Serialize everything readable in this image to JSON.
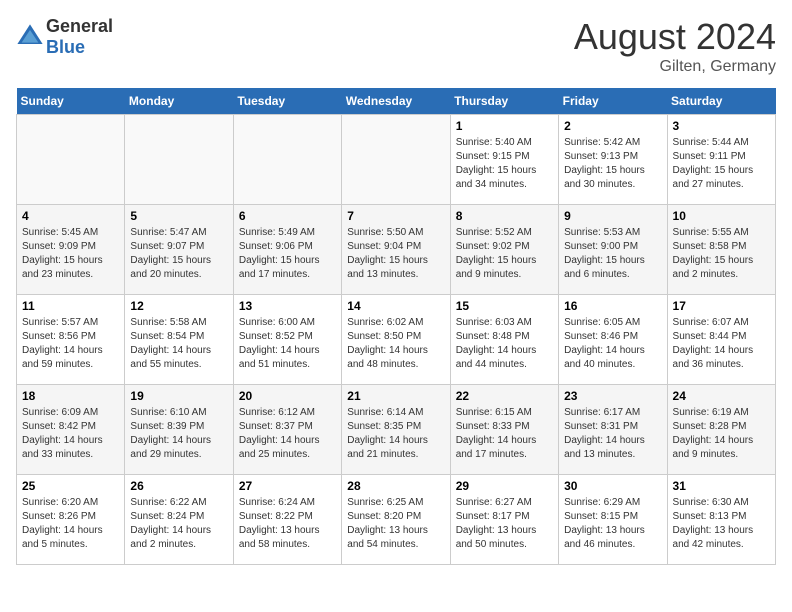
{
  "header": {
    "logo": {
      "general": "General",
      "blue": "Blue"
    },
    "month_year": "August 2024",
    "location": "Gilten, Germany"
  },
  "weekdays": [
    "Sunday",
    "Monday",
    "Tuesday",
    "Wednesday",
    "Thursday",
    "Friday",
    "Saturday"
  ],
  "weeks": [
    [
      {
        "day": "",
        "info": ""
      },
      {
        "day": "",
        "info": ""
      },
      {
        "day": "",
        "info": ""
      },
      {
        "day": "",
        "info": ""
      },
      {
        "day": "1",
        "info": "Sunrise: 5:40 AM\nSunset: 9:15 PM\nDaylight: 15 hours\nand 34 minutes."
      },
      {
        "day": "2",
        "info": "Sunrise: 5:42 AM\nSunset: 9:13 PM\nDaylight: 15 hours\nand 30 minutes."
      },
      {
        "day": "3",
        "info": "Sunrise: 5:44 AM\nSunset: 9:11 PM\nDaylight: 15 hours\nand 27 minutes."
      }
    ],
    [
      {
        "day": "4",
        "info": "Sunrise: 5:45 AM\nSunset: 9:09 PM\nDaylight: 15 hours\nand 23 minutes."
      },
      {
        "day": "5",
        "info": "Sunrise: 5:47 AM\nSunset: 9:07 PM\nDaylight: 15 hours\nand 20 minutes."
      },
      {
        "day": "6",
        "info": "Sunrise: 5:49 AM\nSunset: 9:06 PM\nDaylight: 15 hours\nand 17 minutes."
      },
      {
        "day": "7",
        "info": "Sunrise: 5:50 AM\nSunset: 9:04 PM\nDaylight: 15 hours\nand 13 minutes."
      },
      {
        "day": "8",
        "info": "Sunrise: 5:52 AM\nSunset: 9:02 PM\nDaylight: 15 hours\nand 9 minutes."
      },
      {
        "day": "9",
        "info": "Sunrise: 5:53 AM\nSunset: 9:00 PM\nDaylight: 15 hours\nand 6 minutes."
      },
      {
        "day": "10",
        "info": "Sunrise: 5:55 AM\nSunset: 8:58 PM\nDaylight: 15 hours\nand 2 minutes."
      }
    ],
    [
      {
        "day": "11",
        "info": "Sunrise: 5:57 AM\nSunset: 8:56 PM\nDaylight: 14 hours\nand 59 minutes."
      },
      {
        "day": "12",
        "info": "Sunrise: 5:58 AM\nSunset: 8:54 PM\nDaylight: 14 hours\nand 55 minutes."
      },
      {
        "day": "13",
        "info": "Sunrise: 6:00 AM\nSunset: 8:52 PM\nDaylight: 14 hours\nand 51 minutes."
      },
      {
        "day": "14",
        "info": "Sunrise: 6:02 AM\nSunset: 8:50 PM\nDaylight: 14 hours\nand 48 minutes."
      },
      {
        "day": "15",
        "info": "Sunrise: 6:03 AM\nSunset: 8:48 PM\nDaylight: 14 hours\nand 44 minutes."
      },
      {
        "day": "16",
        "info": "Sunrise: 6:05 AM\nSunset: 8:46 PM\nDaylight: 14 hours\nand 40 minutes."
      },
      {
        "day": "17",
        "info": "Sunrise: 6:07 AM\nSunset: 8:44 PM\nDaylight: 14 hours\nand 36 minutes."
      }
    ],
    [
      {
        "day": "18",
        "info": "Sunrise: 6:09 AM\nSunset: 8:42 PM\nDaylight: 14 hours\nand 33 minutes."
      },
      {
        "day": "19",
        "info": "Sunrise: 6:10 AM\nSunset: 8:39 PM\nDaylight: 14 hours\nand 29 minutes."
      },
      {
        "day": "20",
        "info": "Sunrise: 6:12 AM\nSunset: 8:37 PM\nDaylight: 14 hours\nand 25 minutes."
      },
      {
        "day": "21",
        "info": "Sunrise: 6:14 AM\nSunset: 8:35 PM\nDaylight: 14 hours\nand 21 minutes."
      },
      {
        "day": "22",
        "info": "Sunrise: 6:15 AM\nSunset: 8:33 PM\nDaylight: 14 hours\nand 17 minutes."
      },
      {
        "day": "23",
        "info": "Sunrise: 6:17 AM\nSunset: 8:31 PM\nDaylight: 14 hours\nand 13 minutes."
      },
      {
        "day": "24",
        "info": "Sunrise: 6:19 AM\nSunset: 8:28 PM\nDaylight: 14 hours\nand 9 minutes."
      }
    ],
    [
      {
        "day": "25",
        "info": "Sunrise: 6:20 AM\nSunset: 8:26 PM\nDaylight: 14 hours\nand 5 minutes."
      },
      {
        "day": "26",
        "info": "Sunrise: 6:22 AM\nSunset: 8:24 PM\nDaylight: 14 hours\nand 2 minutes."
      },
      {
        "day": "27",
        "info": "Sunrise: 6:24 AM\nSunset: 8:22 PM\nDaylight: 13 hours\nand 58 minutes."
      },
      {
        "day": "28",
        "info": "Sunrise: 6:25 AM\nSunset: 8:20 PM\nDaylight: 13 hours\nand 54 minutes."
      },
      {
        "day": "29",
        "info": "Sunrise: 6:27 AM\nSunset: 8:17 PM\nDaylight: 13 hours\nand 50 minutes."
      },
      {
        "day": "30",
        "info": "Sunrise: 6:29 AM\nSunset: 8:15 PM\nDaylight: 13 hours\nand 46 minutes."
      },
      {
        "day": "31",
        "info": "Sunrise: 6:30 AM\nSunset: 8:13 PM\nDaylight: 13 hours\nand 42 minutes."
      }
    ]
  ]
}
